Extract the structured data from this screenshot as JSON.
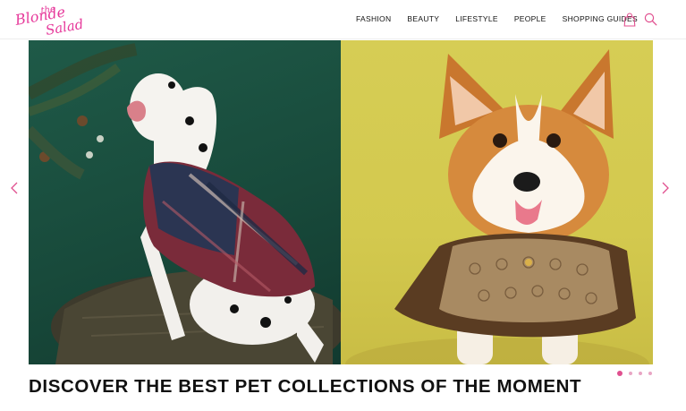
{
  "brand": {
    "logo_text_line1": "the",
    "logo_text_line2": "Blonde",
    "logo_text_line3": "Salad",
    "logo_color": "#e6389a"
  },
  "nav": {
    "items": [
      {
        "label": "FASHION"
      },
      {
        "label": "BEAUTY"
      },
      {
        "label": "LIFESTYLE"
      },
      {
        "label": "PEOPLE"
      },
      {
        "label": "SHOPPING GUIDES"
      }
    ],
    "icons": [
      "shopping-bag-icon",
      "search-icon"
    ],
    "accent_color": "#e0508f"
  },
  "slider": {
    "images": [
      {
        "subject": "dalmatian in knit sweater on quilted dog bed",
        "background": "#1f5a48"
      },
      {
        "subject": "corgi in monogram cape",
        "background": "#d6cd55"
      }
    ],
    "prev_icon": "chevron-left-icon",
    "next_icon": "chevron-right-icon",
    "slide_count": 4,
    "active_slide": 1
  },
  "article": {
    "headline": "DISCOVER THE BEST PET COLLECTIONS OF THE MOMENT"
  }
}
